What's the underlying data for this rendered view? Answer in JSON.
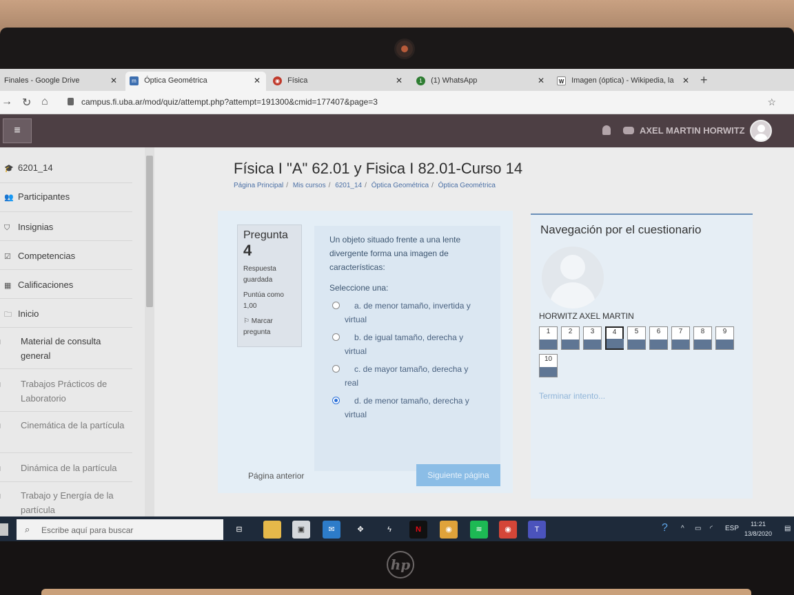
{
  "browser": {
    "tabs": [
      {
        "title": "Finales - Google Drive",
        "icon": "google-drive-icon"
      },
      {
        "title": "Óptica Geométrica",
        "icon": "moodle-icon"
      },
      {
        "title": "Física",
        "icon": "globe-icon"
      },
      {
        "title": "(1) WhatsApp",
        "icon": "whatsapp-icon"
      },
      {
        "title": "Imagen (óptica) - Wikipedia, la",
        "icon": "wikipedia-icon"
      }
    ],
    "url": "campus.fi.uba.ar/mod/quiz/attempt.php?attempt=191300&cmid=177407&page=3"
  },
  "header": {
    "user_name": "AXEL MARTIN HORWITZ"
  },
  "sidebar": {
    "items": [
      {
        "label": "6201_14",
        "icon": "graduation-cap-icon"
      },
      {
        "label": "Participantes",
        "icon": "users-icon"
      },
      {
        "label": "Insignias",
        "icon": "shield-icon"
      },
      {
        "label": "Competencias",
        "icon": "checkbox-icon"
      },
      {
        "label": "Calificaciones",
        "icon": "table-icon"
      },
      {
        "label": "Inicio",
        "icon": "folder-icon"
      },
      {
        "label": "Material de consulta general",
        "icon": "folder-icon"
      },
      {
        "label": "Trabajos Prácticos de Laboratorio",
        "icon": "folder-icon"
      },
      {
        "label": "Cinemática de la partícula",
        "icon": "folder-icon"
      },
      {
        "label": "Dinámica de la partícula",
        "icon": "folder-icon"
      },
      {
        "label": "Trabajo y Energía de la partícula",
        "icon": "folder-icon"
      }
    ]
  },
  "course": {
    "title": "Física I \"A\" 62.01 y Fisica I 82.01-Curso 14",
    "breadcrumb": [
      "Página Principal",
      "Mis cursos",
      "6201_14",
      "Óptica Geométrica",
      "Óptica Geométrica"
    ]
  },
  "question": {
    "label": "Pregunta",
    "number": "4",
    "status": "Respuesta guardada",
    "score_label": "Puntúa como 1,00",
    "flag_label": "Marcar pregunta",
    "text": "Un objeto situado frente a una lente divergente forma una imagen de características:",
    "prompt": "Seleccione una:",
    "options": [
      {
        "line1": "a. de menor tamaño, invertida y",
        "line2": "virtual",
        "selected": false
      },
      {
        "line1": "b. de igual tamaño, derecha y",
        "line2": "virtual",
        "selected": false
      },
      {
        "line1": "c. de mayor tamaño, derecha y",
        "line2": "real",
        "selected": false
      },
      {
        "line1": "d. de menor tamaño, derecha y",
        "line2": "virtual",
        "selected": true
      }
    ]
  },
  "page_nav": {
    "previous": "Página anterior",
    "next": "Siguiente página"
  },
  "quiz_nav": {
    "title": "Navegación por el cuestionario",
    "user": "HORWITZ AXEL MARTIN",
    "questions": [
      "1",
      "2",
      "3",
      "4",
      "5",
      "6",
      "7",
      "8",
      "9",
      "10"
    ],
    "current": "4",
    "finish": "Terminar intento..."
  },
  "taskbar": {
    "search_placeholder": "Escribe aquí para buscar",
    "language": "ESP",
    "time": "11:21",
    "date": "13/8/2020"
  }
}
